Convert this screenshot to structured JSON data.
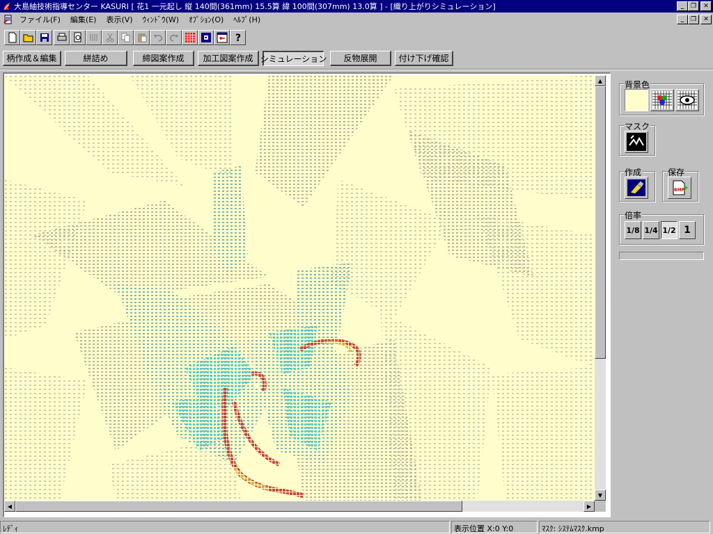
{
  "window": {
    "title": "大島紬技術指導センター KASURI [ 花1 一元起し 縦 140間(361mm) 15.5算 緯 100間(307mm) 13.0算 ] - [織り上がりシミュレーション]",
    "controls": {
      "minimize": "_",
      "restore": "❐",
      "close": "✕"
    }
  },
  "menu": {
    "items": [
      "ファイル(F)",
      "編集(E)",
      "表示(V)",
      "ｳｨﾝﾄﾞｳ(W)",
      "ｵﾌﾟｼｮﾝ(O)",
      "ﾍﾙﾌﾟ(H)"
    ]
  },
  "toolbar": {
    "buttons": [
      "new-file-icon",
      "open-folder-icon",
      "save-icon",
      "print-icon",
      "print-preview-icon",
      "columns-icon",
      "cut-icon",
      "copy-icon",
      "paste-icon",
      "undo-icon",
      "redo-icon",
      "grid-icon",
      "fill-icon",
      "import-icon",
      "help-icon"
    ]
  },
  "modes": {
    "tabs": [
      "柄作成＆編集",
      "絣詰め",
      "締図案作成",
      "加工図案作成",
      "シミュレーション",
      "反物展開",
      "付け下げ確認"
    ],
    "active_index": 4
  },
  "panel": {
    "bg_color_label": "背景色",
    "mask_label": "マスク",
    "create_label": "作成",
    "save_label": "保存",
    "zoom_label": "倍率",
    "zoom_options": [
      "1/8",
      "1/4",
      "1/2",
      "1"
    ],
    "zoom_active": "1/2",
    "bg_swatch_color": "#fffdcc"
  },
  "status": {
    "ready": "ﾚﾃﾞｨ",
    "position": "表示位置  X:0  Y:0",
    "mask": "ﾏｽｸ: ｼｽﾃﾑﾏｽｸ.kmp"
  },
  "colors": {
    "fabric_bg": "#fffdcc",
    "pattern_gray": "#b4b29a",
    "pattern_teal": "#6fb8b4",
    "pattern_cyan": "#5cd0cc",
    "pattern_red": "#c8463a",
    "pattern_gold": "#d8b84a"
  }
}
